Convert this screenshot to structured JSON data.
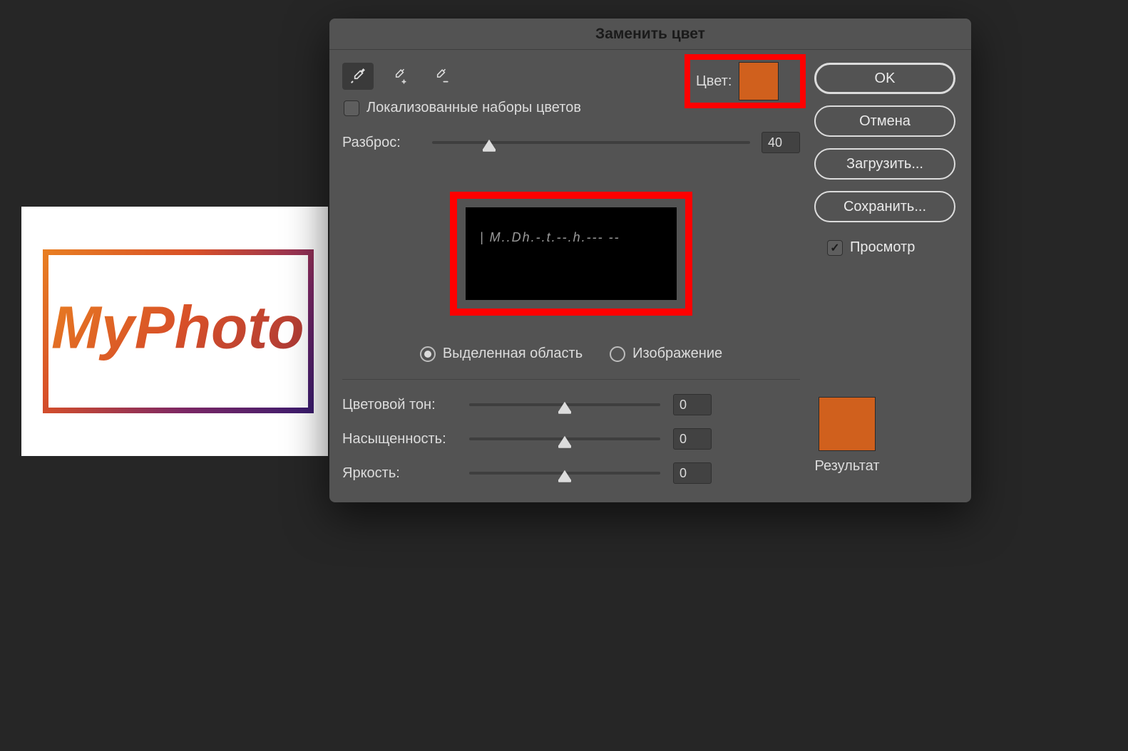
{
  "canvas": {
    "logo_text": "MyPhoto"
  },
  "dialog": {
    "title": "Заменить цвет",
    "eyedroppers": {
      "main": "eyedropper",
      "add": "eyedropper-add",
      "sub": "eyedropper-subtract"
    },
    "color_label": "Цвет:",
    "color_hex": "#d0601d",
    "localized_checkbox": {
      "label": "Локализованные наборы цветов",
      "checked": false
    },
    "fuzziness": {
      "label": "Разброс:",
      "value": "40",
      "thumb_percent": 18
    },
    "preview_mode": {
      "selection": "Выделенная область",
      "image": "Изображение",
      "selected": "selection"
    },
    "replace": {
      "hue": {
        "label": "Цветовой тон:",
        "value": "0",
        "thumb_percent": 50
      },
      "sat": {
        "label": "Насыщенность:",
        "value": "0",
        "thumb_percent": 50
      },
      "lig": {
        "label": "Яркость:",
        "value": "0",
        "thumb_percent": 50
      },
      "result_label": "Результат",
      "result_hex": "#d0601d"
    },
    "buttons": {
      "ok": "OK",
      "cancel": "Отмена",
      "load": "Загрузить...",
      "save": "Сохранить..."
    },
    "preview_check": {
      "label": "Просмотр",
      "checked": true
    }
  }
}
